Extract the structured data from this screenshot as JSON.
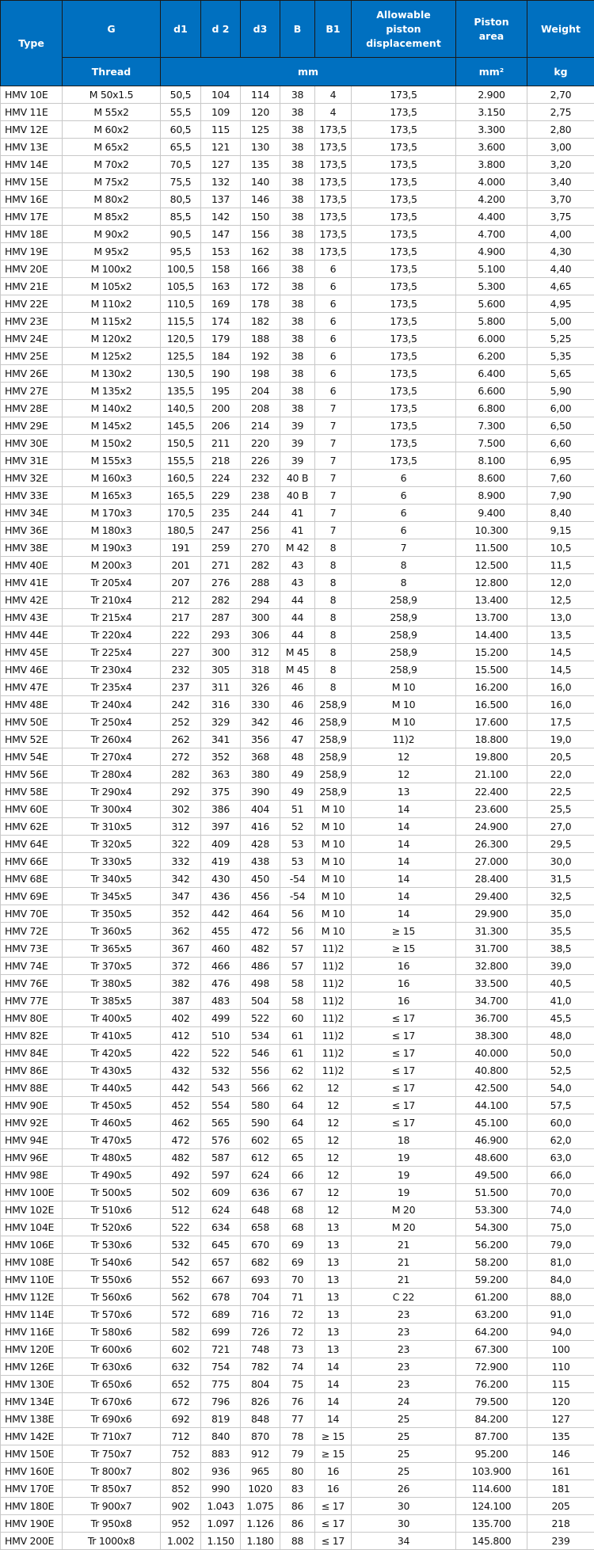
{
  "header": {
    "type": "Type",
    "g": "G",
    "d1": "d1",
    "d2": "d 2",
    "d3": "d3",
    "b": "B",
    "b1": "B1",
    "allowable": "Allowable piston displacement",
    "piston_area": "Piston area",
    "weight": "Weight",
    "thread": "Thread",
    "unit_mm": "mm",
    "unit_mm2": "mm²",
    "unit_kg": "kg"
  },
  "colors": {
    "header_bg": "#0070c0",
    "header_text": "#ffffff",
    "grid": "#c8c8c8"
  },
  "rows": [
    [
      "HMV 10E",
      "M 50x1.5",
      "50,5",
      "104",
      "114",
      "38",
      "4",
      "173,5",
      "2.900",
      "2,70"
    ],
    [
      "HMV 11E",
      "M 55x2",
      "55,5",
      "109",
      "120",
      "38",
      "4",
      "173,5",
      "3.150",
      "2,75"
    ],
    [
      "HMV 12E",
      "M 60x2",
      "60,5",
      "115",
      "125",
      "38",
      "173,5",
      "173,5",
      "3.300",
      "2,80"
    ],
    [
      "HMV 13E",
      "M 65x2",
      "65,5",
      "121",
      "130",
      "38",
      "173,5",
      "173,5",
      "3.600",
      "3,00"
    ],
    [
      "HMV 14E",
      "M 70x2",
      "70,5",
      "127",
      "135",
      "38",
      "173,5",
      "173,5",
      "3.800",
      "3,20"
    ],
    [
      "HMV 15E",
      "M 75x2",
      "75,5",
      "132",
      "140",
      "38",
      "173,5",
      "173,5",
      "4.000",
      "3,40"
    ],
    [
      "HMV 16E",
      "M 80x2",
      "80,5",
      "137",
      "146",
      "38",
      "173,5",
      "173,5",
      "4.200",
      "3,70"
    ],
    [
      "HMV 17E",
      "M 85x2",
      "85,5",
      "142",
      "150",
      "38",
      "173,5",
      "173,5",
      "4.400",
      "3,75"
    ],
    [
      "HMV 18E",
      "M 90x2",
      "90,5",
      "147",
      "156",
      "38",
      "173,5",
      "173,5",
      "4.700",
      "4,00"
    ],
    [
      "HMV 19E",
      "M 95x2",
      "95,5",
      "153",
      "162",
      "38",
      "173,5",
      "173,5",
      "4.900",
      "4,30"
    ],
    [
      "HMV 20E",
      "M 100x2",
      "100,5",
      "158",
      "166",
      "38",
      "6",
      "173,5",
      "5.100",
      "4,40"
    ],
    [
      "HMV 21E",
      "M 105x2",
      "105,5",
      "163",
      "172",
      "38",
      "6",
      "173,5",
      "5.300",
      "4,65"
    ],
    [
      "HMV 22E",
      "M 110x2",
      "110,5",
      "169",
      "178",
      "38",
      "6",
      "173,5",
      "5.600",
      "4,95"
    ],
    [
      "HMV 23E",
      "M 115x2",
      "115,5",
      "174",
      "182",
      "38",
      "6",
      "173,5",
      "5.800",
      "5,00"
    ],
    [
      "HMV 24E",
      "M 120x2",
      "120,5",
      "179",
      "188",
      "38",
      "6",
      "173,5",
      "6.000",
      "5,25"
    ],
    [
      "HMV 25E",
      "M 125x2",
      "125,5",
      "184",
      "192",
      "38",
      "6",
      "173,5",
      "6.200",
      "5,35"
    ],
    [
      "HMV 26E",
      "M 130x2",
      "130,5",
      "190",
      "198",
      "38",
      "6",
      "173,5",
      "6.400",
      "5,65"
    ],
    [
      "HMV 27E",
      "M 135x2",
      "135,5",
      "195",
      "204",
      "38",
      "6",
      "173,5",
      "6.600",
      "5,90"
    ],
    [
      "HMV 28E",
      "M 140x2",
      "140,5",
      "200",
      "208",
      "38",
      "7",
      "173,5",
      "6.800",
      "6,00"
    ],
    [
      "HMV 29E",
      "M 145x2",
      "145,5",
      "206",
      "214",
      "39",
      "7",
      "173,5",
      "7.300",
      "6,50"
    ],
    [
      "HMV 30E",
      "M 150x2",
      "150,5",
      "211",
      "220",
      "39",
      "7",
      "173,5",
      "7.500",
      "6,60"
    ],
    [
      "HMV 31E",
      "M 155x3",
      "155,5",
      "218",
      "226",
      "39",
      "7",
      "173,5",
      "8.100",
      "6,95"
    ],
    [
      "HMV 32E",
      "M 160x3",
      "160,5",
      "224",
      "232",
      "40 B",
      "7",
      "6",
      "8.600",
      "7,60"
    ],
    [
      "HMV 33E",
      "M 165x3",
      "165,5",
      "229",
      "238",
      "40 B",
      "7",
      "6",
      "8.900",
      "7,90"
    ],
    [
      "HMV 34E",
      "M 170x3",
      "170,5",
      "235",
      "244",
      "41",
      "7",
      "6",
      "9.400",
      "8,40"
    ],
    [
      "HMV 36E",
      "M 180x3",
      "180,5",
      "247",
      "256",
      "41",
      "7",
      "6",
      "10.300",
      "9,15"
    ],
    [
      "HMV 38E",
      "M 190x3",
      "191",
      "259",
      "270",
      "M 42",
      "8",
      "7",
      "11.500",
      "10,5"
    ],
    [
      "HMV 40E",
      "M 200x3",
      "201",
      "271",
      "282",
      "43",
      "8",
      "8",
      "12.500",
      "11,5"
    ],
    [
      "HMV 41E",
      "Tr 205x4",
      "207",
      "276",
      "288",
      "43",
      "8",
      "8",
      "12.800",
      "12,0"
    ],
    [
      "HMV 42E",
      "Tr 210x4",
      "212",
      "282",
      "294",
      "44",
      "8",
      "258,9",
      "13.400",
      "12,5"
    ],
    [
      "HMV 43E",
      "Tr 215x4",
      "217",
      "287",
      "300",
      "44",
      "8",
      "258,9",
      "13.700",
      "13,0"
    ],
    [
      "HMV 44E",
      "Tr 220x4",
      "222",
      "293",
      "306",
      "44",
      "8",
      "258,9",
      "14.400",
      "13,5"
    ],
    [
      "HMV 45E",
      "Tr 225x4",
      "227",
      "300",
      "312",
      "M 45",
      "8",
      "258,9",
      "15.200",
      "14,5"
    ],
    [
      "HMV 46E",
      "Tr 230x4",
      "232",
      "305",
      "318",
      "M 45",
      "8",
      "258,9",
      "15.500",
      "14,5"
    ],
    [
      "HMV 47E",
      "Tr 235x4",
      "237",
      "311",
      "326",
      "46",
      "8",
      "M 10",
      "16.200",
      "16,0"
    ],
    [
      "HMV 48E",
      "Tr 240x4",
      "242",
      "316",
      "330",
      "46",
      "258,9",
      "M 10",
      "16.500",
      "16,0"
    ],
    [
      "HMV 50E",
      "Tr 250x4",
      "252",
      "329",
      "342",
      "46",
      "258,9",
      "M 10",
      "17.600",
      "17,5"
    ],
    [
      "HMV 52E",
      "Tr 260x4",
      "262",
      "341",
      "356",
      "47",
      "258,9",
      "11)2",
      "18.800",
      "19,0"
    ],
    [
      "HMV 54E",
      "Tr 270x4",
      "272",
      "352",
      "368",
      "48",
      "258,9",
      "12",
      "19.800",
      "20,5"
    ],
    [
      "HMV 56E",
      "Tr 280x4",
      "282",
      "363",
      "380",
      "49",
      "258,9",
      "12",
      "21.100",
      "22,0"
    ],
    [
      "HMV 58E",
      "Tr 290x4",
      "292",
      "375",
      "390",
      "49",
      "258,9",
      "13",
      "22.400",
      "22,5"
    ],
    [
      "HMV 60E",
      "Tr 300x4",
      "302",
      "386",
      "404",
      "51",
      "M 10",
      "14",
      "23.600",
      "25,5"
    ],
    [
      "HMV 62E",
      "Tr 310x5",
      "312",
      "397",
      "416",
      "52",
      "M 10",
      "14",
      "24.900",
      "27,0"
    ],
    [
      "HMV 64E",
      "Tr 320x5",
      "322",
      "409",
      "428",
      "53",
      "M 10",
      "14",
      "26.300",
      "29,5"
    ],
    [
      "HMV 66E",
      "Tr 330x5",
      "332",
      "419",
      "438",
      "53",
      "M 10",
      "14",
      "27.000",
      "30,0"
    ],
    [
      "HMV 68E",
      "Tr 340x5",
      "342",
      "430",
      "450",
      "-54",
      "M 10",
      "14",
      "28.400",
      "31,5"
    ],
    [
      "HMV 69E",
      "Tr 345x5",
      "347",
      "436",
      "456",
      "-54",
      "M 10",
      "14",
      "29.400",
      "32,5"
    ],
    [
      "HMV 70E",
      "Tr 350x5",
      "352",
      "442",
      "464",
      "56",
      "M 10",
      "14",
      "29.900",
      "35,0"
    ],
    [
      "HMV 72E",
      "Tr 360x5",
      "362",
      "455",
      "472",
      "56",
      "M 10",
      "≥ 15",
      "31.300",
      "35,5"
    ],
    [
      "HMV 73E",
      "Tr 365x5",
      "367",
      "460",
      "482",
      "57",
      "11)2",
      "≥ 15",
      "31.700",
      "38,5"
    ],
    [
      "HMV 74E",
      "Tr 370x5",
      "372",
      "466",
      "486",
      "57",
      "11)2",
      "16",
      "32.800",
      "39,0"
    ],
    [
      "HMV 76E",
      "Tr 380x5",
      "382",
      "476",
      "498",
      "58",
      "11)2",
      "16",
      "33.500",
      "40,5"
    ],
    [
      "HMV 77E",
      "Tr 385x5",
      "387",
      "483",
      "504",
      "58",
      "11)2",
      "16",
      "34.700",
      "41,0"
    ],
    [
      "HMV 80E",
      "Tr 400x5",
      "402",
      "499",
      "522",
      "60",
      "11)2",
      "≤ 17",
      "36.700",
      "45,5"
    ],
    [
      "HMV 82E",
      "Tr 410x5",
      "412",
      "510",
      "534",
      "61",
      "11)2",
      "≤ 17",
      "38.300",
      "48,0"
    ],
    [
      "HMV 84E",
      "Tr 420x5",
      "422",
      "522",
      "546",
      "61",
      "11)2",
      "≤ 17",
      "40.000",
      "50,0"
    ],
    [
      "HMV 86E",
      "Tr 430x5",
      "432",
      "532",
      "556",
      "62",
      "11)2",
      "≤ 17",
      "40.800",
      "52,5"
    ],
    [
      "HMV 88E",
      "Tr 440x5",
      "442",
      "543",
      "566",
      "62",
      "12",
      "≤ 17",
      "42.500",
      "54,0"
    ],
    [
      "HMV 90E",
      "Tr 450x5",
      "452",
      "554",
      "580",
      "64",
      "12",
      "≤ 17",
      "44.100",
      "57,5"
    ],
    [
      "HMV 92E",
      "Tr 460x5",
      "462",
      "565",
      "590",
      "64",
      "12",
      "≤ 17",
      "45.100",
      "60,0"
    ],
    [
      "HMV 94E",
      "Tr 470x5",
      "472",
      "576",
      "602",
      "65",
      "12",
      "18",
      "46.900",
      "62,0"
    ],
    [
      "HMV 96E",
      "Tr 480x5",
      "482",
      "587",
      "612",
      "65",
      "12",
      "19",
      "48.600",
      "63,0"
    ],
    [
      "HMV 98E",
      "Tr 490x5",
      "492",
      "597",
      "624",
      "66",
      "12",
      "19",
      "49.500",
      "66,0"
    ],
    [
      "HMV 100E",
      "Tr 500x5",
      "502",
      "609",
      "636",
      "67",
      "12",
      "19",
      "51.500",
      "70,0"
    ],
    [
      "HMV 102E",
      "Tr 510x6",
      "512",
      "624",
      "648",
      "68",
      "12",
      "M 20",
      "53.300",
      "74,0"
    ],
    [
      "HMV 104E",
      "Tr 520x6",
      "522",
      "634",
      "658",
      "68",
      "13",
      "M 20",
      "54.300",
      "75,0"
    ],
    [
      "HMV 106E",
      "Tr 530x6",
      "532",
      "645",
      "670",
      "69",
      "13",
      "21",
      "56.200",
      "79,0"
    ],
    [
      "HMV 108E",
      "Tr 540x6",
      "542",
      "657",
      "682",
      "69",
      "13",
      "21",
      "58.200",
      "81,0"
    ],
    [
      "HMV 110E",
      "Tr 550x6",
      "552",
      "667",
      "693",
      "70",
      "13",
      "21",
      "59.200",
      "84,0"
    ],
    [
      "HMV 112E",
      "Tr 560x6",
      "562",
      "678",
      "704",
      "71",
      "13",
      "C 22",
      "61.200",
      "88,0"
    ],
    [
      "HMV 114E",
      "Tr 570x6",
      "572",
      "689",
      "716",
      "72",
      "13",
      "23",
      "63.200",
      "91,0"
    ],
    [
      "HMV 116E",
      "Tr 580x6",
      "582",
      "699",
      "726",
      "72",
      "13",
      "23",
      "64.200",
      "94,0"
    ],
    [
      "HMV 120E",
      "Tr 600x6",
      "602",
      "721",
      "748",
      "73",
      "13",
      "23",
      "67.300",
      "100"
    ],
    [
      "HMV 126E",
      "Tr 630x6",
      "632",
      "754",
      "782",
      "74",
      "14",
      "23",
      "72.900",
      "110"
    ],
    [
      "HMV 130E",
      "Tr 650x6",
      "652",
      "775",
      "804",
      "75",
      "14",
      "23",
      "76.200",
      "115"
    ],
    [
      "HMV 134E",
      "Tr 670x6",
      "672",
      "796",
      "826",
      "76",
      "14",
      "24",
      "79.500",
      "120"
    ],
    [
      "HMV 138E",
      "Tr 690x6",
      "692",
      "819",
      "848",
      "77",
      "14",
      "25",
      "84.200",
      "127"
    ],
    [
      "HMV 142E",
      "Tr 710x7",
      "712",
      "840",
      "870",
      "78",
      "≥ 15",
      "25",
      "87.700",
      "135"
    ],
    [
      "HMV 150E",
      "Tr 750x7",
      "752",
      "883",
      "912",
      "79",
      "≥ 15",
      "25",
      "95.200",
      "146"
    ],
    [
      "HMV 160E",
      "Tr 800x7",
      "802",
      "936",
      "965",
      "80",
      "16",
      "25",
      "103.900",
      "161"
    ],
    [
      "HMV 170E",
      "Tr 850x7",
      "852",
      "990",
      "1020",
      "83",
      "16",
      "26",
      "114.600",
      "181"
    ],
    [
      "HMV 180E",
      "Tr 900x7",
      "902",
      "1.043",
      "1.075",
      "86",
      "≤ 17",
      "30",
      "124.100",
      "205"
    ],
    [
      "HMV 190E",
      "Tr 950x8",
      "952",
      "1.097",
      "1.126",
      "86",
      "≤ 17",
      "30",
      "135.700",
      "218"
    ],
    [
      "HMV 200E",
      "Tr 1000x8",
      "1.002",
      "1.150",
      "1.180",
      "88",
      "≤ 17",
      "34",
      "145.800",
      "239"
    ]
  ]
}
